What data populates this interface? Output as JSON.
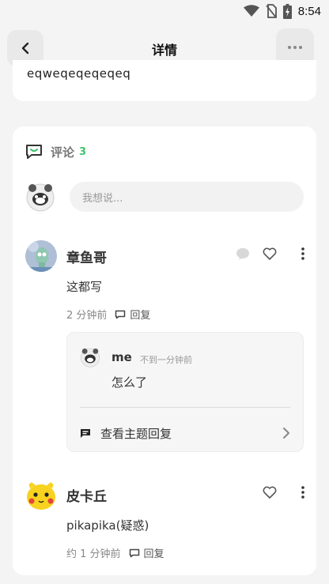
{
  "status_bar": {
    "time": "8:54",
    "icons": [
      "wifi-icon",
      "no-sim-icon",
      "battery-charging-icon"
    ]
  },
  "header": {
    "title": "详情",
    "back_icon": "chevron-left-icon",
    "more_icon": "more-horizontal-icon"
  },
  "post": {
    "text": "eqweqeqeqeqeq"
  },
  "comments": {
    "title": "评论",
    "count": "3",
    "input_placeholder": "我想说...",
    "accent_color": "#3ec46d",
    "items": [
      {
        "author": "章鱼哥",
        "text": "这都写",
        "time": "2 分钟前",
        "reply_label": "回复",
        "replies": [
          {
            "author": "me",
            "time": "不到一分钟前",
            "text": "怎么了"
          }
        ],
        "view_thread_label": "查看主题回复"
      },
      {
        "author": "皮卡丘",
        "text": "pikapika(疑惑)",
        "time": "约 1 分钟前",
        "reply_label": "回复"
      }
    ]
  }
}
